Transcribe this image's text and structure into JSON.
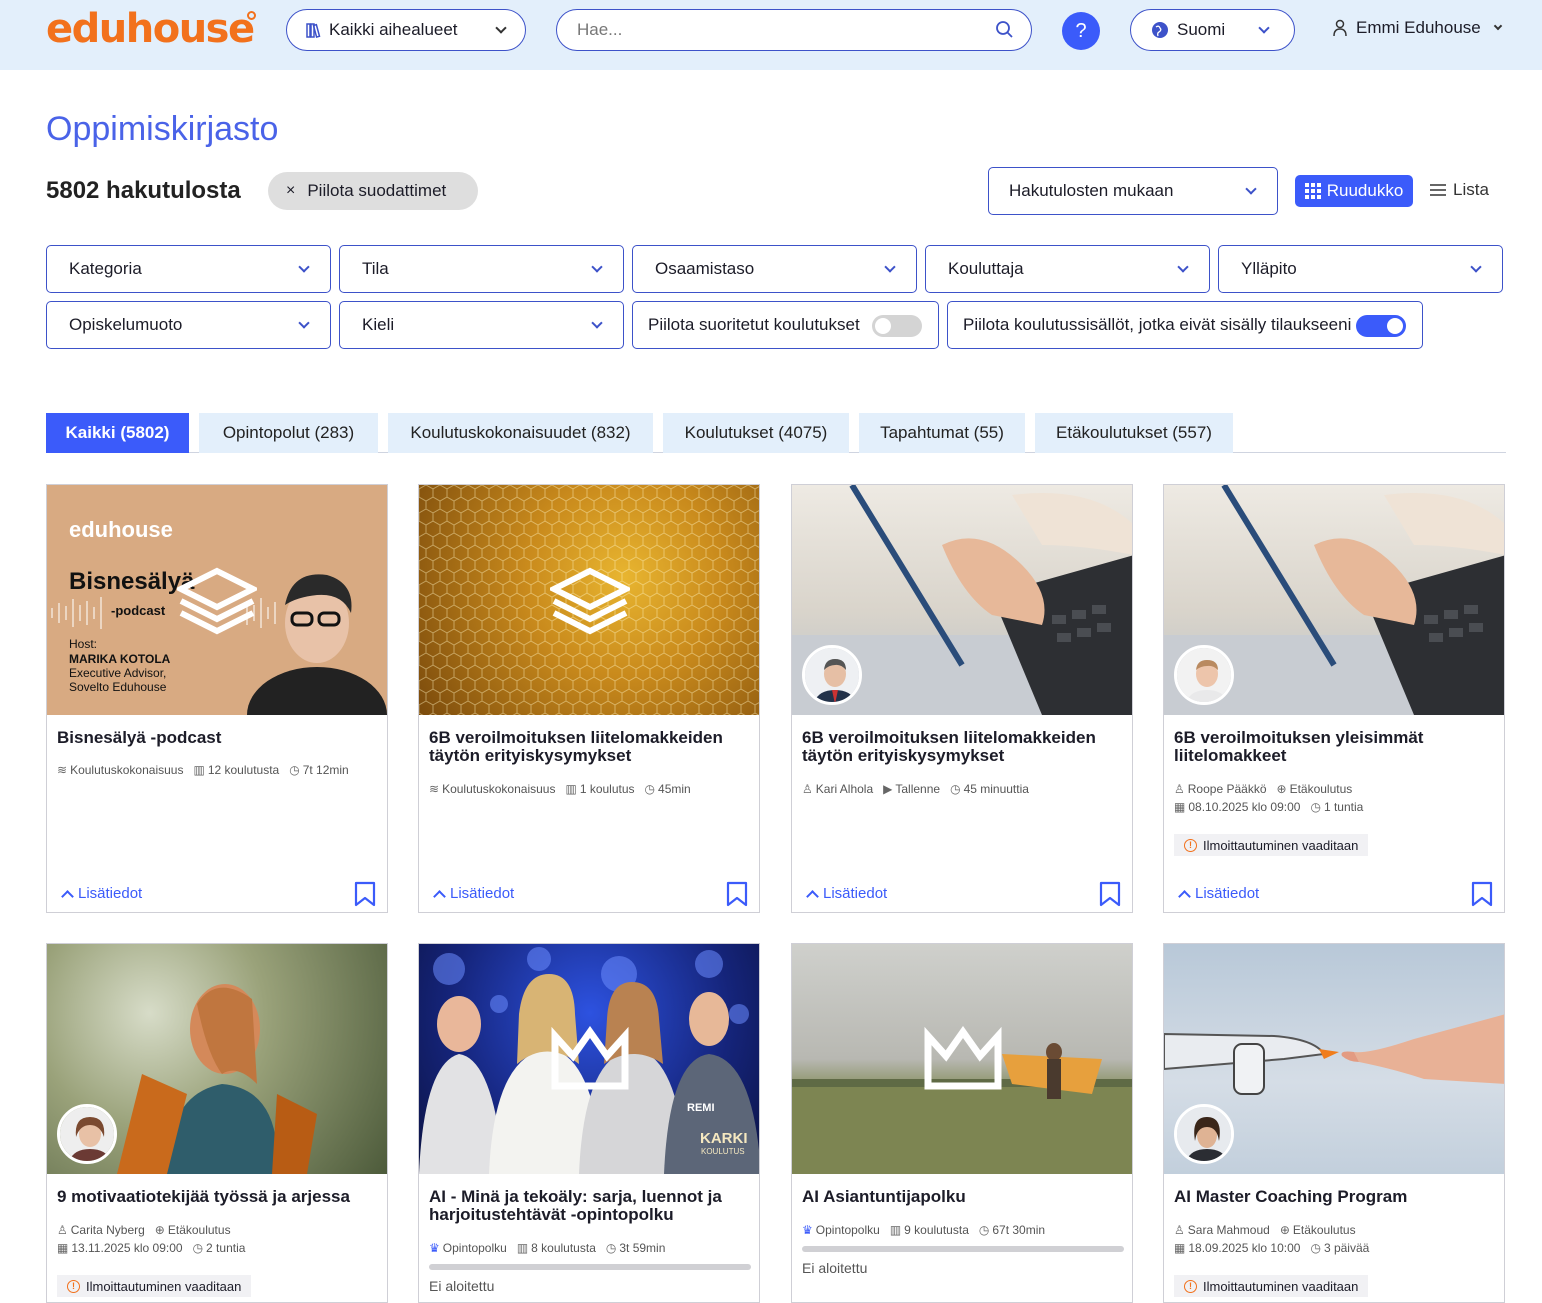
{
  "header": {
    "logo": "eduhouse",
    "category_select": "Kaikki aihealueet",
    "search_placeholder": "Hae...",
    "help": "?",
    "language": "Suomi",
    "user": "Emmi Eduhouse"
  },
  "page": {
    "title": "Oppimiskirjasto",
    "results": "5802 hakutulosta",
    "hide_filters": "Piilota suodattimet",
    "sort": "Hakutulosten mukaan",
    "grid_view": "Ruudukko",
    "list_view": "Lista"
  },
  "filters": {
    "kategoria": "Kategoria",
    "tila": "Tila",
    "osaamistaso": "Osaamistaso",
    "kouluttaja": "Kouluttaja",
    "yllapito": "Ylläpito",
    "opiskelumuoto": "Opiskelumuoto",
    "kieli": "Kieli",
    "hide_completed": "Piilota suoritetut koulutukset",
    "hide_not_subscribed": "Piilota koulutussisällöt, jotka eivät sisälly tilaukseeni"
  },
  "tabs": [
    "Kaikki (5802)",
    "Opintopolut (283)",
    "Koulutuskokonaisuudet (832)",
    "Koulutukset (4075)",
    "Tapahtumat (55)",
    "Etäkoulutukset (557)"
  ],
  "common": {
    "more": "Lisätiedot",
    "registration_required": "Ilmoittautuminen vaaditaan",
    "not_started": "Ei aloitettu"
  },
  "cards": [
    {
      "title": "Bisnesälyä -podcast",
      "meta1": [
        "Koulutuskokonaisuus",
        "12 koulutusta",
        "7t 12min"
      ],
      "image_text": {
        "brand": "eduhouse",
        "title": "Bisnesälyä",
        "sub": "-podcast",
        "host": "Host:",
        "name": "MARIKA KOTOLA",
        "role1": "Executive Advisor,",
        "role2": "Sovelto Eduhouse"
      }
    },
    {
      "title": "6B veroilmoituksen liitelomakkeiden täytön erityiskysymykset",
      "meta1": [
        "Koulutuskokonaisuus",
        "1 koulutus",
        "45min"
      ]
    },
    {
      "title": "6B veroilmoituksen liitelomakkeiden täytön erityiskysymykset",
      "meta1": [
        "Kari Alhola",
        "Tallenne",
        "45 minuuttia"
      ]
    },
    {
      "title": "6B veroilmoituksen yleisimmät liitelomakkeet",
      "meta1": [
        "Roope Pääkkö",
        "Etäkoulutus"
      ],
      "meta2": [
        "08.10.2025 klo 09:00",
        "1 tuntia"
      ]
    },
    {
      "title": "9 motivaatiotekijää työssä ja arjessa",
      "meta1": [
        "Carita Nyberg",
        "Etäkoulutus"
      ],
      "meta2": [
        "13.11.2025 klo 09:00",
        "2 tuntia"
      ]
    },
    {
      "title": "AI - Minä ja tekoäly: sarja, luennot ja harjoitustehtävät -opintopolku",
      "meta1": [
        "Opintopolku",
        "8 koulutusta",
        "3t 59min"
      ],
      "progress": 0,
      "image_text": {
        "badge1": "KARKI",
        "badge2": "KOULUTUS",
        "shirt": "REMI"
      }
    },
    {
      "title": "AI Asiantuntijapolku",
      "meta1": [
        "Opintopolku",
        "9 koulutusta",
        "67t 30min"
      ],
      "progress": 0
    },
    {
      "title": "AI Master Coaching Program",
      "meta1": [
        "Sara Mahmoud",
        "Etäkoulutus"
      ],
      "meta2": [
        "18.09.2025 klo 10:00",
        "3 päivää"
      ]
    }
  ],
  "colors": {
    "accent": "#3b5bfa",
    "brand": "#f2711c",
    "header_bg": "#e3effb"
  }
}
